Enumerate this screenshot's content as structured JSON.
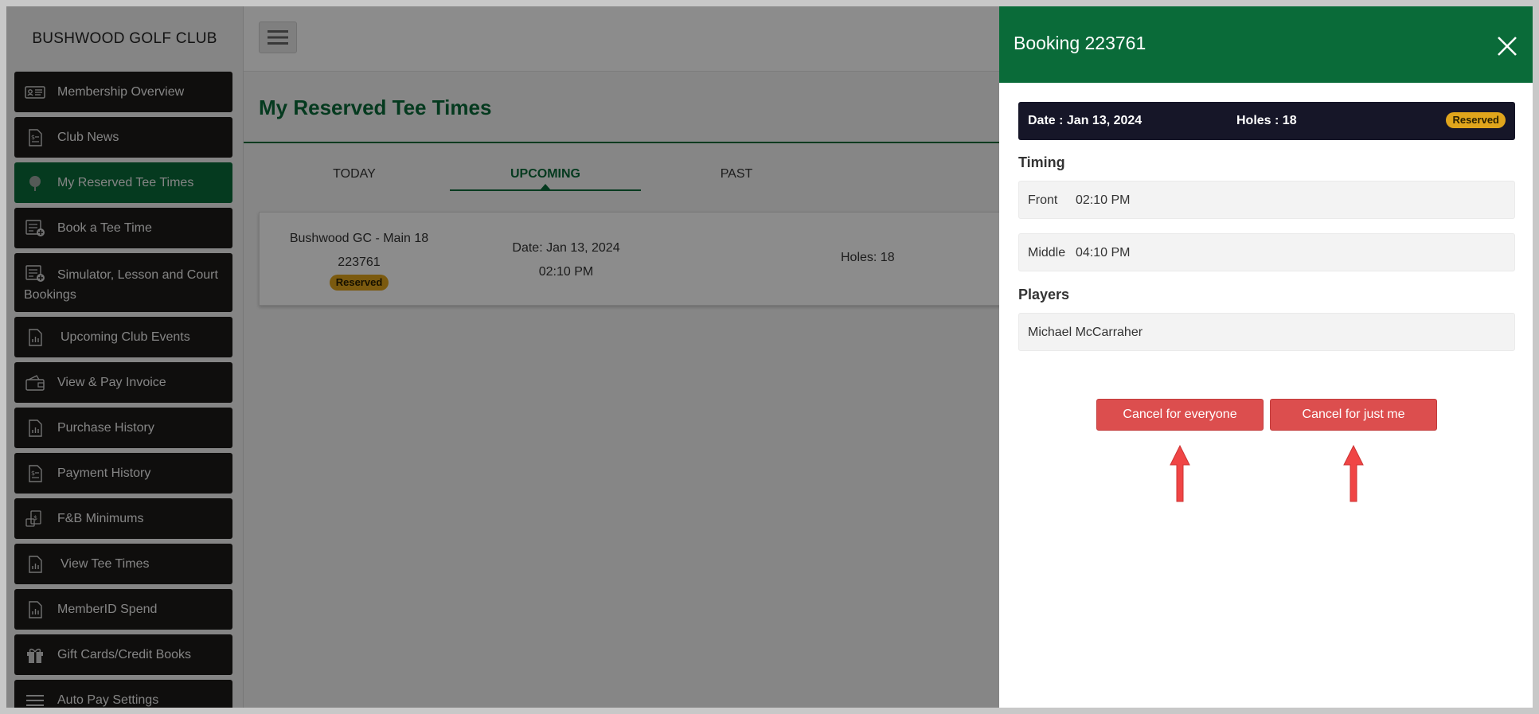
{
  "app": {
    "club_name": "BUSHWOOD GOLF CLUB"
  },
  "sidebar": {
    "items": [
      {
        "label": "Membership Overview",
        "icon": "id-card-icon"
      },
      {
        "label": "Club News",
        "icon": "document-dollar-icon"
      },
      {
        "label": "My Reserved Tee Times",
        "icon": "golf-ball-icon",
        "active": true
      },
      {
        "label": "Book a Tee Time",
        "icon": "list-add-icon"
      },
      {
        "label": "Simulator, Lesson and Court Bookings",
        "icon": "list-add-icon"
      },
      {
        "label": "Upcoming Club Events",
        "icon": "chart-document-icon"
      },
      {
        "label": "View & Pay Invoice",
        "icon": "wallet-icon"
      },
      {
        "label": "Purchase History",
        "icon": "chart-document-icon"
      },
      {
        "label": "Payment History",
        "icon": "document-dollar-icon"
      },
      {
        "label": "F&B Minimums",
        "icon": "cash-icon"
      },
      {
        "label": "View Tee Times",
        "icon": "chart-document-icon"
      },
      {
        "label": "MemberID Spend",
        "icon": "chart-document-icon"
      },
      {
        "label": "Gift Cards/Credit Books",
        "icon": "gift-icon"
      },
      {
        "label": "Auto Pay Settings",
        "icon": "settings-list-icon"
      }
    ]
  },
  "main": {
    "page_title": "My Reserved Tee Times",
    "tabs": [
      {
        "label": "TODAY"
      },
      {
        "label": "UPCOMING",
        "active": true
      },
      {
        "label": "PAST"
      }
    ],
    "booking_card": {
      "course": "Bushwood GC - Main 18",
      "booking_id": "223761",
      "status": "Reserved",
      "date": "Date: Jan 13, 2024",
      "time": "02:10 PM",
      "holes": "Holes: 18"
    }
  },
  "drawer": {
    "title": "Booking 223761",
    "summary": {
      "date": "Date : Jan 13, 2024",
      "holes": "Holes : 18",
      "status": "Reserved"
    },
    "timing_heading": "Timing",
    "timing": [
      {
        "label": "Front",
        "time": "02:10 PM"
      },
      {
        "label": "Middle",
        "time": "04:10 PM"
      }
    ],
    "players_heading": "Players",
    "players": [
      "Michael McCarraher"
    ],
    "buttons": {
      "cancel_everyone": "Cancel for everyone",
      "cancel_me": "Cancel for just me"
    }
  },
  "colors": {
    "brand_green": "#0a6b39",
    "nav_dark": "#1d1b19",
    "badge_gold": "#e0a51c",
    "danger": "#dc4e4e",
    "annotation_arrow": "#f04545"
  }
}
